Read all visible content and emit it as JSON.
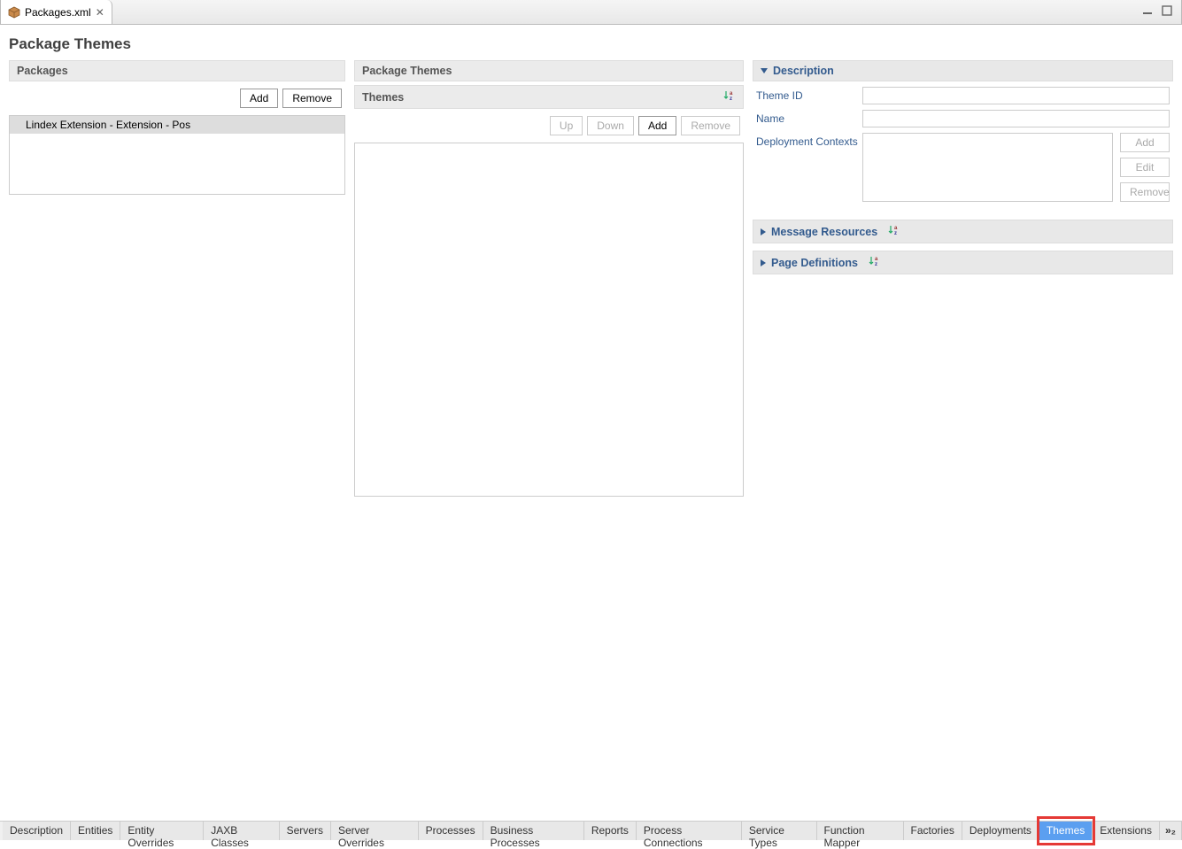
{
  "tab": {
    "filename": "Packages.xml",
    "close_symbol": "✕"
  },
  "page_title": "Package Themes",
  "left": {
    "section_title": "Packages",
    "add_label": "Add",
    "remove_label": "Remove",
    "items": [
      "Lindex Extension - Extension - Pos"
    ],
    "selected_index": 0
  },
  "middle": {
    "section_title": "Package Themes",
    "themes_title": "Themes",
    "up_label": "Up",
    "down_label": "Down",
    "add_label": "Add",
    "remove_label": "Remove"
  },
  "right": {
    "description": {
      "title": "Description",
      "theme_id_label": "Theme ID",
      "theme_id_value": "",
      "name_label": "Name",
      "name_value": "",
      "dc_label": "Deployment Contexts",
      "add_label": "Add",
      "edit_label": "Edit",
      "remove_label": "Remove"
    },
    "message_resources": {
      "title": "Message Resources"
    },
    "page_definitions": {
      "title": "Page Definitions"
    }
  },
  "bottom_tabs": {
    "items": [
      "Description",
      "Entities",
      "Entity Overrides",
      "JAXB Classes",
      "Servers",
      "Server Overrides",
      "Processes",
      "Business Processes",
      "Reports",
      "Process Connections",
      "Service Types",
      "Function Mapper",
      "Factories",
      "Deployments",
      "Themes",
      "Extensions"
    ],
    "overflow": "»₂",
    "active_index": 14
  }
}
